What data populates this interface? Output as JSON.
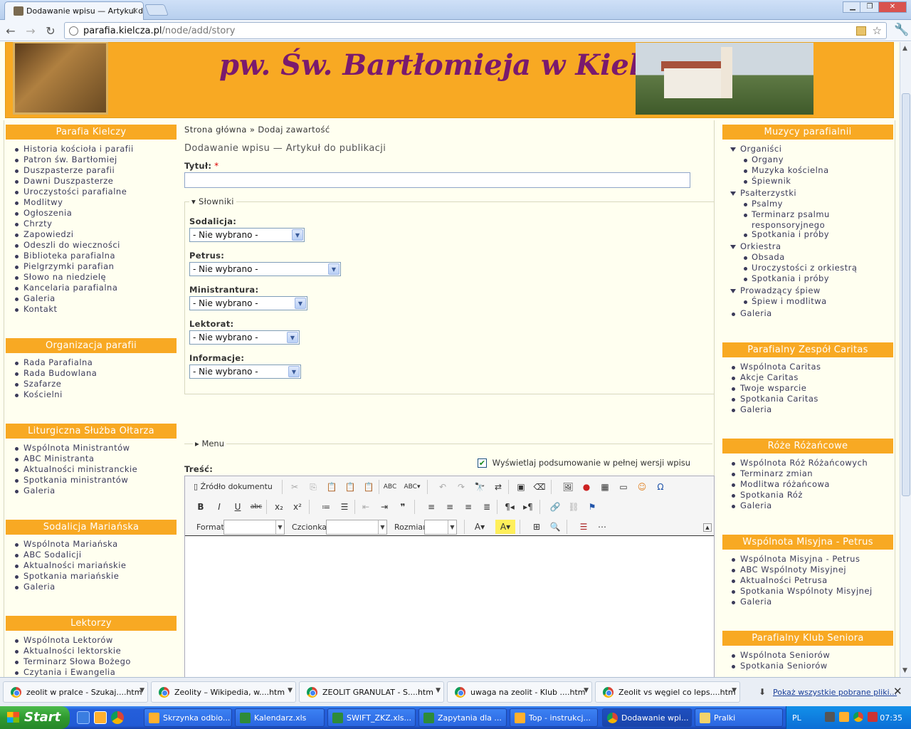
{
  "browser": {
    "tab_title": "Dodawanie wpisu — Artykuł do",
    "url_host": "parafia.kielcza.pl",
    "url_path": "/node/add/story"
  },
  "site": {
    "title": "pw. Św. Bartłomieja w Kielczy"
  },
  "left_blocks": [
    {
      "title": "Parafia Kielczy",
      "items": [
        "Historia kościoła i parafii",
        "Patron św. Bartłomiej",
        "Duszpasterze parafii",
        "Dawni Duszpasterze",
        "Uroczystości parafialne",
        "Modlitwy",
        "Ogłoszenia",
        "Chrzty",
        "Zapowiedzi",
        "Odeszli do wieczności",
        "Biblioteka parafialna",
        "Pielgrzymki parafian",
        "Słowo na niedzielę",
        "Kancelaria parafialna",
        "Galeria",
        "Kontakt"
      ]
    },
    {
      "title": "Organizacja parafii",
      "items": [
        "Rada Parafialna",
        "Rada Budowlana",
        "Szafarze",
        "Kościelni"
      ]
    },
    {
      "title": "Liturgiczna Służba Ołtarza",
      "items": [
        "Wspólnota Ministrantów",
        "ABC Ministranta",
        "Aktualności ministranckie",
        "Spotkania ministrantów",
        "Galeria"
      ]
    },
    {
      "title": "Sodalicja Mariańska",
      "items": [
        "Wspólnota Mariańska",
        "ABC Sodalicji",
        "Aktualności mariańskie",
        "Spotkania mariańskie",
        "Galeria"
      ]
    },
    {
      "title": "Lektorzy",
      "items": [
        "Wspólnota Lektorów",
        "Aktualności lektorskie",
        "Terminarz Słowa Bożego",
        "Czytania i Ewangelia"
      ]
    }
  ],
  "right_blocks": {
    "muzycy": {
      "title": "Muzycy parafialnii",
      "items": [
        "Organiści",
        "Organy",
        "Muzyka kościelna",
        "Śpiewnik",
        "Psałterzystki",
        "Psalmy",
        "Terminarz psalmu responsoryjnego",
        "Spotkania i próby",
        "Orkiestra",
        "Obsada",
        "Uroczystości z orkiestrą",
        "Spotkania i próby",
        "Prowadzący śpiew",
        "Śpiew i modlitwa",
        "Galeria"
      ]
    },
    "caritas": {
      "title": "Parafialny Zespół Caritas",
      "items": [
        "Wspólnota Caritas",
        "Akcje Caritas",
        "Twoje wsparcie",
        "Spotkania Caritas",
        "Galeria"
      ]
    },
    "roze": {
      "title": "Róże Różańcowe",
      "items": [
        "Wspólnota Róż Różańcowych",
        "Terminarz zmian",
        "Modlitwa różańcowa",
        "Spotkania Róż",
        "Galeria"
      ]
    },
    "petrus": {
      "title": "Wspólnota Misyjna - Petrus",
      "items": [
        "Wspólnota Misyjna - Petrus",
        "ABC Wspólnoty Misyjnej",
        "Aktualności Petrusa",
        "Spotkania Wspólnoty Misyjnej",
        "Galeria"
      ]
    },
    "seniorzy": {
      "title": "Parafialny Klub Seniora",
      "items": [
        "Wspólnota Seniorów",
        "Spotkania Seniorów"
      ]
    }
  },
  "main": {
    "breadcrumb": "Strona główna » Dodaj zawartość",
    "page_title": "Dodawanie wpisu — Artykuł do publikacji",
    "title_label": "Tytuł:",
    "required_mark": "*",
    "slowniki_legend": "Słowniki",
    "selects": [
      {
        "label": "Sodalicja:",
        "value": "- Nie wybrano -"
      },
      {
        "label": "Petrus:",
        "value": "- Nie wybrano -"
      },
      {
        "label": "Ministrantura:",
        "value": "- Nie wybrano -"
      },
      {
        "label": "Lektorat:",
        "value": "- Nie wybrano -"
      },
      {
        "label": "Informacje:",
        "value": "- Nie wybrano -"
      }
    ],
    "menu_legend": "Menu",
    "summary_checkbox": "Wyświetlaj podsumowanie w pełnej wersji wpisu",
    "body_label": "Treść:",
    "editor": {
      "source_button": "Źródło dokumentu",
      "format_label": "Format",
      "font_label": "Czcionka",
      "size_label": "Rozmiar"
    }
  },
  "downloads": {
    "items": [
      "zeolit w pralce - Szukaj....htm",
      "Zeolity – Wikipedia, w....htm",
      "ZEOLIT GRANULAT - S....htm",
      "uwaga na zeolit - Klub ....htm",
      "Zeolit vs węgiel co leps....htm"
    ],
    "show_all": "Pokaż wszystkie pobrane pliki..."
  },
  "taskbar": {
    "start": "Start",
    "items": [
      "Skrzynka odbio...",
      "Kalendarz.xls",
      "SWIFT_ZKZ.xls...",
      "Zapytania dla ...",
      "Top - instrukcj...",
      "Dodawanie wpi...",
      "Pralki"
    ],
    "lang": "PL",
    "time": "07:35"
  }
}
